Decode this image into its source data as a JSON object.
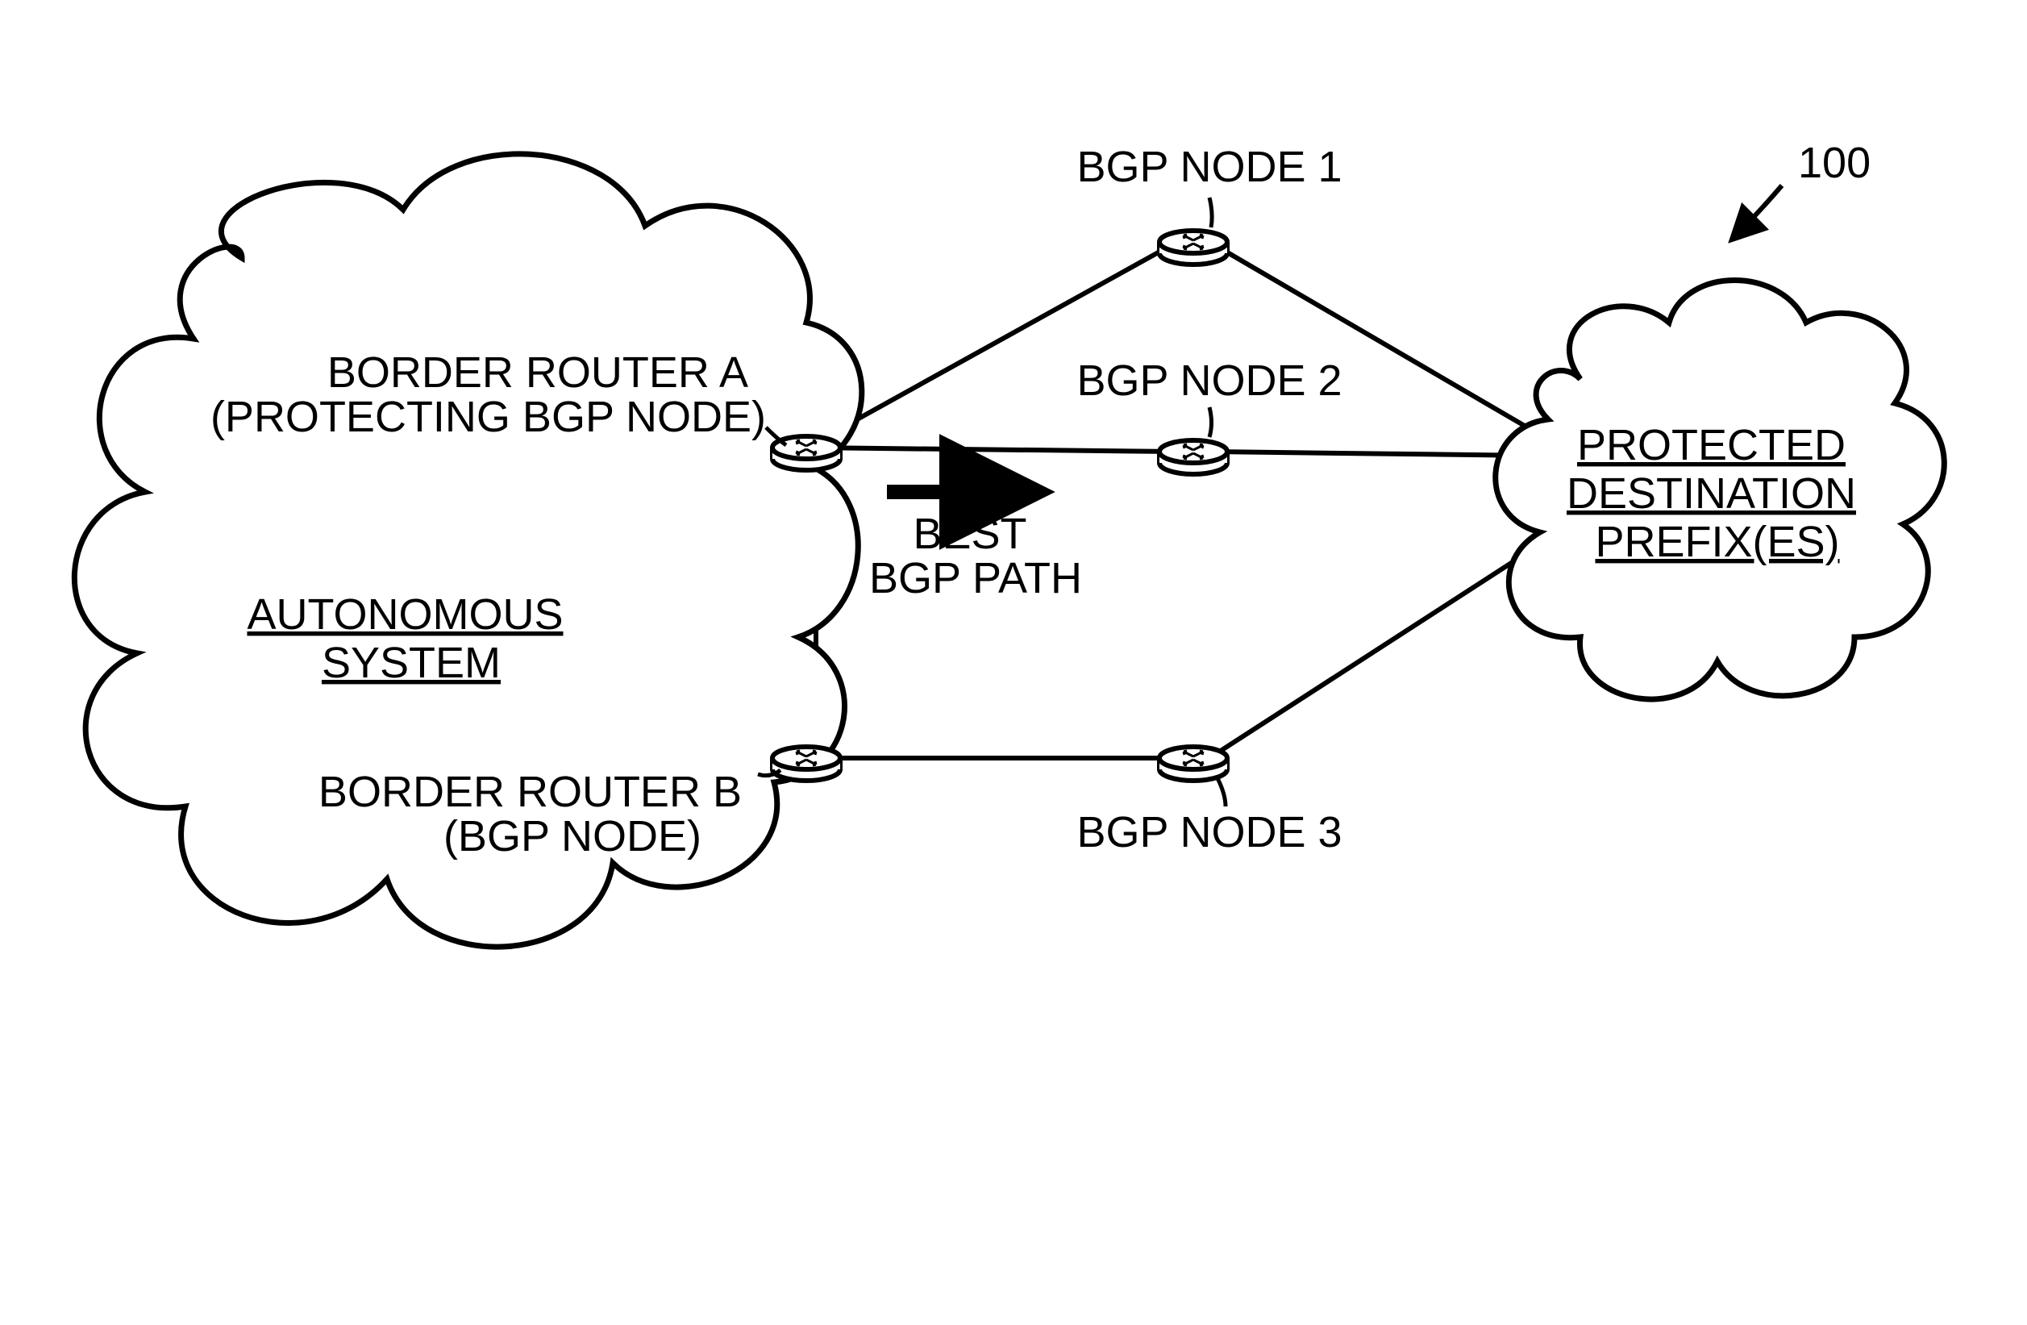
{
  "figure_ref": "100",
  "as_cloud": {
    "line1": "AUTONOMOUS",
    "line2": "SYSTEM"
  },
  "dest_cloud": {
    "line1": "PROTECTED",
    "line2": "DESTINATION",
    "line3": "PREFIX(ES)"
  },
  "router_a": {
    "line1": "BORDER ROUTER A",
    "line2": "(PROTECTING BGP NODE)"
  },
  "router_b": {
    "line1": "BORDER ROUTER B",
    "line2": "(BGP NODE)"
  },
  "node1_label": "BGP NODE 1",
  "node2_label": "BGP NODE 2",
  "node3_label": "BGP NODE 3",
  "best_path": {
    "line1": "BEST",
    "line2": "BGP PATH"
  }
}
